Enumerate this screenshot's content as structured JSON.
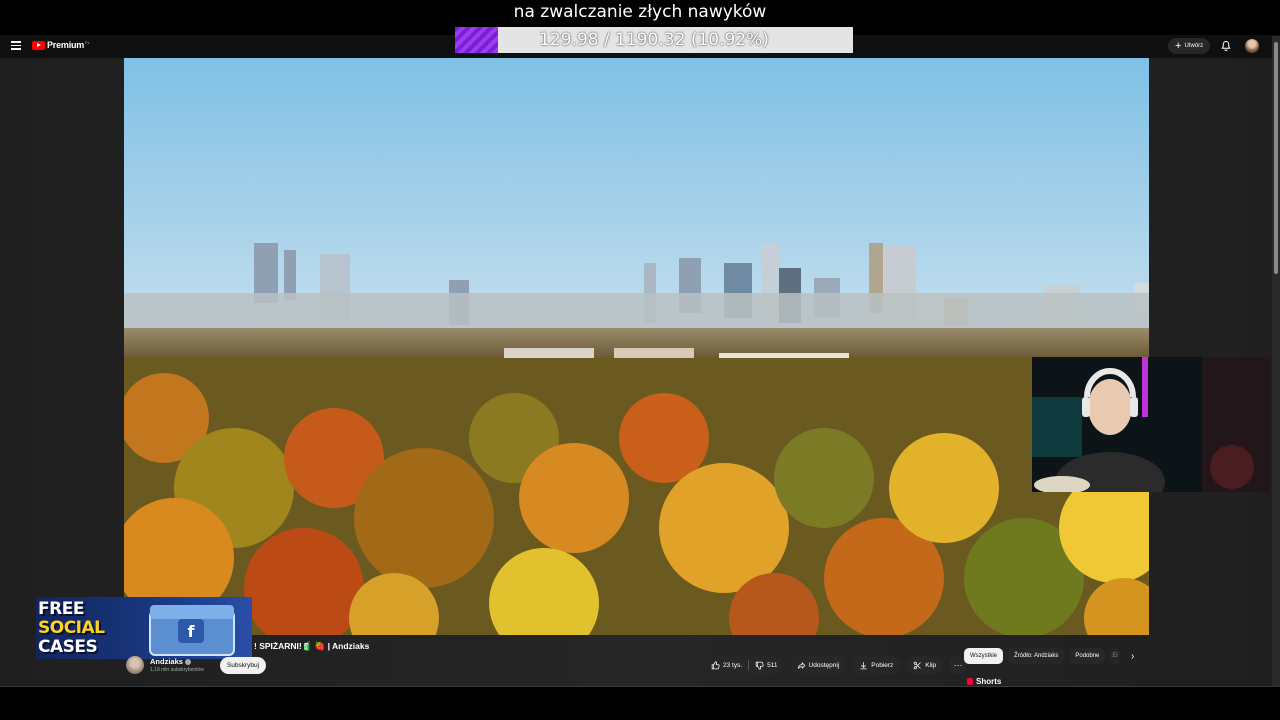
{
  "overlay": {
    "title": "na zwalczanie złych nawyków",
    "progress_text": "129.98 / 1190.32 (10.92%)",
    "progress_fraction": 0.1092,
    "progress_color": "#8a2be2"
  },
  "topbar": {
    "menu_icon": "hamburger-menu-icon",
    "logo_text": "Premium",
    "logo_region": "PL",
    "create_label": "Utwórz",
    "bell_icon": "bell-icon"
  },
  "sponsor": {
    "line1": "FREE",
    "line2": "SOCIAL",
    "line3": "CASES"
  },
  "video": {
    "title": "! SPIŻARNI!🧃 🍓 | Andziaks"
  },
  "channel": {
    "name": "Andziaks",
    "subscribers": "1,19 mln subskrybentów",
    "subscribe_label": "Subskrybuj"
  },
  "actions": {
    "likes": "23 tys.",
    "dislikes": "511",
    "share": "Udostępnij",
    "download": "Pobierz",
    "clip": "Klip",
    "more": "···"
  },
  "chips": {
    "all": "Wszystkie",
    "source": "Źródło: Andziaks",
    "similar": "Podobne",
    "cut": "El"
  },
  "shorts": {
    "label": "Shorts"
  }
}
